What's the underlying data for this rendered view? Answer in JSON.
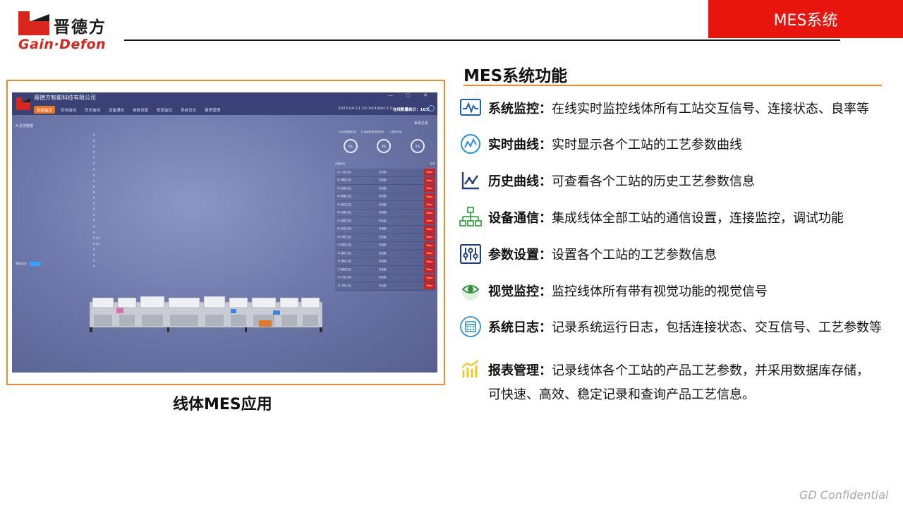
{
  "header": {
    "brand_cn": "晋德方",
    "brand_en": "Gain·Defon",
    "tag": "MES系统"
  },
  "screenshot": {
    "company": "晋德方智能科技有限公司",
    "window_controls": "—  ▢  ✕",
    "nav": [
      "系统监控",
      "实时曲线",
      "历史曲线",
      "设备通信",
      "参数设置",
      "视觉监控",
      "系统日志",
      "报表管理"
    ],
    "datetime": "2023-04-11 10:34:43",
    "version": "Ver:1.0",
    "status": "在线数量统计：10大",
    "left_title": "A.总览数据",
    "param_values": [
      "0",
      "0",
      "0",
      "0",
      "0",
      "0",
      "0",
      "0",
      "0",
      "0",
      "0",
      "0",
      "0",
      "0",
      "0",
      "0",
      "0",
      "0",
      "0.43",
      "0.43",
      "0",
      "0",
      "0",
      "0"
    ],
    "toggle_label": "数据状态",
    "right_title": "系统总览",
    "rate_labels": [
      "A.在线数据状态",
      "B.连续数据采集状态",
      "C.通讯状态"
    ],
    "gauges": [
      "0%",
      "0%",
      "0%"
    ],
    "table_header": [
      "设备信息",
      "状态"
    ],
    "rows": [
      {
        "name": "01.上料工站",
        "state": "未连接",
        "btn": "Warn"
      },
      {
        "name": "02.焊接工站",
        "state": "未连接",
        "btn": "Warn"
      },
      {
        "name": "03.检测工站",
        "state": "未连接",
        "btn": "Warn"
      },
      {
        "name": "04.组装工站",
        "state": "未连接",
        "btn": "Warn"
      },
      {
        "name": "05.测试工站",
        "state": "未连接",
        "btn": "Warn"
      },
      {
        "name": "06.点胶工站",
        "state": "未连接",
        "btn": "Warn"
      },
      {
        "name": "07.视觉工站",
        "state": "未连接",
        "btn": "Warn"
      },
      {
        "name": "08.压合工站",
        "state": "未连接",
        "btn": "Warn"
      },
      {
        "name": "09.扫码工站",
        "state": "未连接",
        "btn": "Warn"
      },
      {
        "name": "10.贴标工站",
        "state": "未连接",
        "btn": "Warn"
      },
      {
        "name": "11.锁付工站",
        "state": "未连接",
        "btn": "Warn"
      },
      {
        "name": "12.清洁工站",
        "state": "未连接",
        "btn": "Warn"
      },
      {
        "name": "13.复检工站",
        "state": "未连接",
        "btn": "Warn"
      },
      {
        "name": "14.打包工站",
        "state": "未连接",
        "btn": "Warn"
      },
      {
        "name": "15.下料工站",
        "state": "未连接",
        "btn": "Warn"
      }
    ]
  },
  "caption": "线体MES应用",
  "functions": {
    "title": "MES系统功能",
    "items": [
      {
        "name": "系统监控：",
        "desc": "在线实时监控线体所有工站交互信号、连接状态、良率等",
        "icon": "monitor-wave-icon"
      },
      {
        "name": "实时曲线：",
        "desc": "实时显示各个工站的工艺参数曲线",
        "icon": "realtime-curve-icon"
      },
      {
        "name": "历史曲线：",
        "desc": "可查看各个工站的历史工艺参数信息",
        "icon": "history-curve-icon"
      },
      {
        "name": "设备通信：",
        "desc": "集成线体全部工站的通信设置，连接监控，调试功能",
        "icon": "network-tree-icon"
      },
      {
        "name": "参数设置：",
        "desc": "设置各个工站的工艺参数信息",
        "icon": "settings-sliders-icon"
      },
      {
        "name": "视觉监控：",
        "desc": "监控线体所有带有视觉功能的视觉信号",
        "icon": "eye-icon"
      },
      {
        "name": "系统日志：",
        "desc": "记录系统运行日志，包括连接状态、交互信号、工艺参数等",
        "icon": "calendar-log-icon"
      },
      {
        "name": "报表管理：",
        "desc": "记录线体各个工站的产品工艺参数，并采用数据库存储，",
        "icon": "report-chart-icon"
      }
    ],
    "last_desc_line2": "可快速、高效、稳定记录和查询产品工艺信息。"
  },
  "footer": "GD Confidential",
  "colors": {
    "accent_red": "#e8150f",
    "accent_orange": "#ee8a2a",
    "icon_blue": "#1f5fb8"
  }
}
